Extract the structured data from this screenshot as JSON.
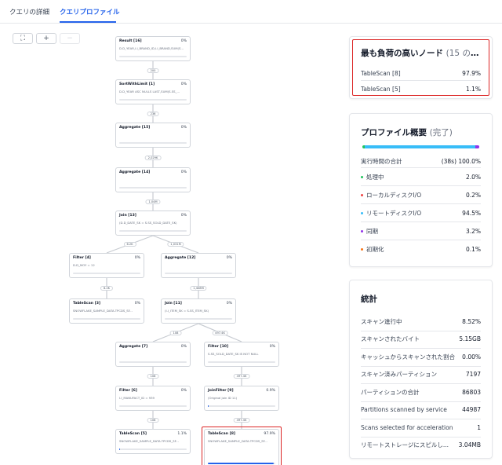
{
  "tabs": [
    {
      "label": "クエリの詳細",
      "active": false
    },
    {
      "label": "クエリプロファイル",
      "active": true
    }
  ],
  "toolbar": {
    "fit_icon": "⛶",
    "zoom_in_icon": "+",
    "zoom_out_icon": "−"
  },
  "colors": {
    "accent": "#2563eb",
    "highlight": "#dc2626",
    "processing": "#22c55e",
    "local_disk": "#ef4444",
    "remote_disk": "#38bdf8",
    "sync": "#9333ea",
    "init": "#f97316",
    "total": "#22d3ee"
  },
  "graph": {
    "nodes": [
      {
        "id": "result",
        "title": "Result [16]",
        "pct": "0%",
        "sub": "D.D_YEAR,I.I_BRAND_ID,I.I_BRAND,SUM(S...",
        "bar": 0
      },
      {
        "id": "sort",
        "title": "SortWithLimit [1]",
        "pct": "0%",
        "sub": "D.D_YEAR ASC NULLS LAST,SUM(S.SS_...",
        "bar": 0
      },
      {
        "id": "agg15",
        "title": "Aggregate [15]",
        "pct": "0%",
        "sub": "",
        "bar": 0
      },
      {
        "id": "agg14",
        "title": "Aggregate [14]",
        "pct": "0%",
        "sub": "",
        "bar": 0
      },
      {
        "id": "join13",
        "title": "Join [13]",
        "pct": "0%",
        "sub": "(D.D_DATE_SK = S.SS_SOLD_DATE_SK)",
        "bar": 0
      },
      {
        "id": "filter4",
        "title": "Filter [4]",
        "pct": "0%",
        "sub": "D.D_MOY = 12",
        "bar": 0
      },
      {
        "id": "agg12",
        "title": "Aggregate [12]",
        "pct": "0%",
        "sub": "",
        "bar": 0
      },
      {
        "id": "scan3",
        "title": "TableScan [3]",
        "pct": "0%",
        "sub": "SNOWFLAKE_SAMPLE_DATA.TPCDS_SF...",
        "bar": 0
      },
      {
        "id": "join11",
        "title": "Join [11]",
        "pct": "0%",
        "sub": "(I.I_ITEM_SK = S.SS_ITEM_SK)",
        "bar": 0
      },
      {
        "id": "agg7",
        "title": "Aggregate [7]",
        "pct": "0%",
        "sub": "",
        "bar": 0
      },
      {
        "id": "filter10",
        "title": "Filter [10]",
        "pct": "0%",
        "sub": "S.SS_SOLD_DATE_SK IS NOT NULL",
        "bar": 0
      },
      {
        "id": "filter6",
        "title": "Filter [6]",
        "pct": "0%",
        "sub": "I.I_MANUFACT_ID = 939",
        "bar": 0
      },
      {
        "id": "joinf9",
        "title": "JoinFilter [9]",
        "pct": "0.9%",
        "sub": "(Original join ID 11)",
        "bar": 0.009
      },
      {
        "id": "scan5",
        "title": "TableScan [5]",
        "pct": "1.1%",
        "sub": "SNOWFLAKE_SAMPLE_DATA.TPCDS_SF...",
        "bar": 0.011
      },
      {
        "id": "scan8",
        "title": "TableScan [8]",
        "pct": "97.9%",
        "sub": "SNOWFLAKE_SAMPLE_DATA.TPCDS_SF...",
        "bar": 0.979
      }
    ],
    "edges": [
      {
        "from": "sort",
        "to": "result",
        "label": "200"
      },
      {
        "from": "agg15",
        "to": "sort",
        "label": "236"
      },
      {
        "from": "agg14",
        "to": "agg15",
        "label": "2,029K"
      },
      {
        "from": "join13",
        "to": "agg14",
        "label": "1.04M"
      },
      {
        "from": "filter4",
        "to": "join13",
        "label": "6.2K"
      },
      {
        "from": "agg12",
        "to": "join13",
        "label": "1,031M"
      },
      {
        "from": "scan3",
        "to": "filter4",
        "label": "6.2K"
      },
      {
        "from": "join11",
        "to": "agg12",
        "label": "1,408M"
      },
      {
        "from": "agg7",
        "to": "join11",
        "label": "108"
      },
      {
        "from": "filter10",
        "to": "join11",
        "label": "497.4K"
      },
      {
        "from": "filter6",
        "to": "agg7",
        "label": "108"
      },
      {
        "from": "joinf9",
        "to": "filter10",
        "label": "497.4K"
      },
      {
        "from": "scan5",
        "to": "filter6",
        "label": "108"
      },
      {
        "from": "scan8",
        "to": "joinf9",
        "label": "497.4K"
      }
    ]
  },
  "expensive_nodes": {
    "title": "最も負荷の高いノード",
    "count": "(15 のう...",
    "items": [
      {
        "label": "TableScan [8]",
        "value": "97.9%"
      },
      {
        "label": "TableScan [5]",
        "value": "1.1%"
      }
    ]
  },
  "profile_overview": {
    "title": "プロファイル概要",
    "status": "(完了)",
    "total_label": "実行時間の合計",
    "total_value": "(38s) 100.0%",
    "items": [
      {
        "label": "処理中",
        "value": "2.0%",
        "fraction": 0.02,
        "color": "#22c55e"
      },
      {
        "label": "ローカルディスクI/O",
        "value": "0.2%",
        "fraction": 0.002,
        "color": "#ef4444"
      },
      {
        "label": "リモートディスクI/O",
        "value": "94.5%",
        "fraction": 0.945,
        "color": "#38bdf8"
      },
      {
        "label": "同期",
        "value": "3.2%",
        "fraction": 0.032,
        "color": "#9333ea"
      },
      {
        "label": "初期化",
        "value": "0.1%",
        "fraction": 0.001,
        "color": "#f97316"
      }
    ]
  },
  "statistics": {
    "title": "統計",
    "items": [
      {
        "label": "スキャン進行中",
        "value": "8.52%"
      },
      {
        "label": "スキャンされたバイト",
        "value": "5.15GB"
      },
      {
        "label": "キャッシュからスキャンされた割合",
        "value": "0.00%"
      },
      {
        "label": "スキャン済みパーティション",
        "value": "7197"
      },
      {
        "label": "パーティションの合計",
        "value": "86803"
      },
      {
        "label": "Partitions scanned by service",
        "value": "44987"
      },
      {
        "label": "Scans selected for acceleration",
        "value": "1"
      },
      {
        "label": "リモートストレージにスピルし...",
        "value": "3.04MB"
      }
    ]
  }
}
